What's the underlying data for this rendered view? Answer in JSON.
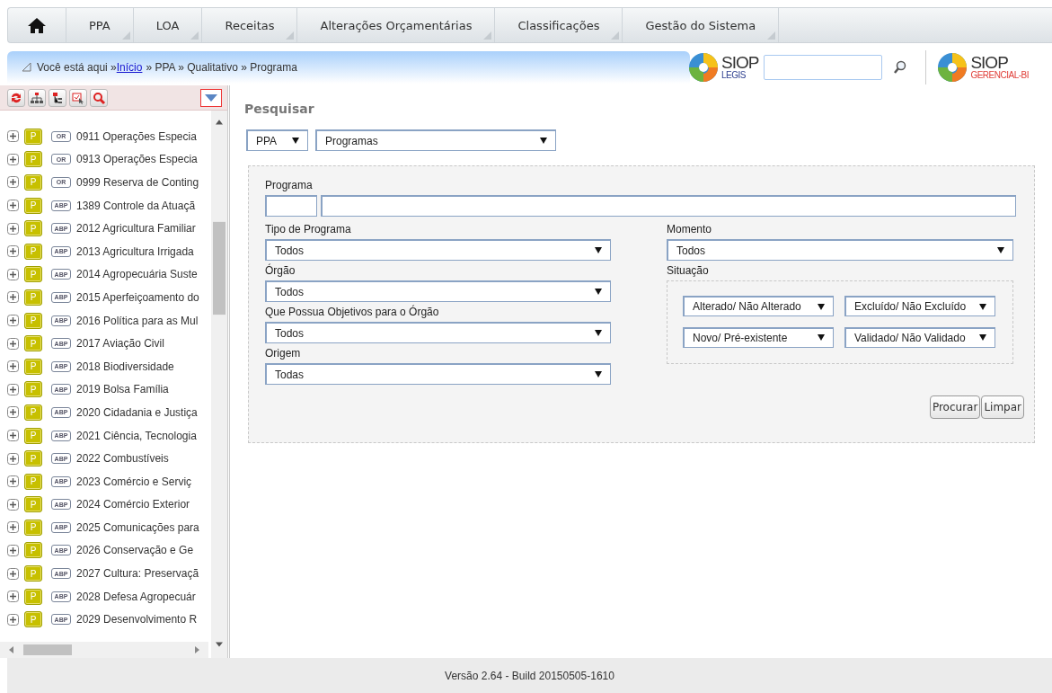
{
  "nav": {
    "items": [
      {
        "kind": "home"
      },
      {
        "kind": "menu",
        "label": "PPA"
      },
      {
        "kind": "menu",
        "label": "LOA"
      },
      {
        "kind": "menu",
        "label": "Receitas"
      },
      {
        "kind": "menu",
        "label": "Alterações Orçamentárias"
      },
      {
        "kind": "menu",
        "label": "Classificações"
      },
      {
        "kind": "menu",
        "label": "Gestão do Sistema"
      }
    ]
  },
  "breadcrumb": {
    "prefix": "Você está aqui »",
    "link": "Início",
    "rest": "» PPA » Qualitativo » Programa"
  },
  "logos": [
    {
      "title": "SIOP",
      "subtitle": "LEGIS",
      "color": "#2e3f8f"
    },
    {
      "title": "SIOP",
      "subtitle": "GERENCIAL-BI",
      "color": "#e0403a"
    }
  ],
  "tree": {
    "items": [
      {
        "badge": "P",
        "tag": "OR",
        "label": "0911 Operações Especia"
      },
      {
        "badge": "P",
        "tag": "OR",
        "label": "0913 Operações Especia"
      },
      {
        "badge": "P",
        "tag": "OR",
        "label": "0999 Reserva de Conting"
      },
      {
        "badge": "P",
        "tag": "ABP",
        "label": "1389 Controle da Atuaçã"
      },
      {
        "badge": "P",
        "tag": "ABP",
        "label": "2012 Agricultura Familiar"
      },
      {
        "badge": "P",
        "tag": "ABP",
        "label": "2013 Agricultura Irrigada"
      },
      {
        "badge": "P",
        "tag": "ABP",
        "label": "2014 Agropecuária Suste"
      },
      {
        "badge": "P",
        "tag": "ABP",
        "label": "2015 Aperfeiçoamento do"
      },
      {
        "badge": "P",
        "tag": "ABP",
        "label": "2016 Política para as Mul"
      },
      {
        "badge": "P",
        "tag": "ABP",
        "label": "2017 Aviação Civil"
      },
      {
        "badge": "P",
        "tag": "ABP",
        "label": "2018 Biodiversidade"
      },
      {
        "badge": "P",
        "tag": "ABP",
        "label": "2019 Bolsa Família"
      },
      {
        "badge": "P",
        "tag": "ABP",
        "label": "2020 Cidadania e Justiça"
      },
      {
        "badge": "P",
        "tag": "ABP",
        "label": "2021 Ciência, Tecnologia"
      },
      {
        "badge": "P",
        "tag": "ABP",
        "label": "2022 Combustíveis"
      },
      {
        "badge": "P",
        "tag": "ABP",
        "label": "2023 Comércio e Serviç"
      },
      {
        "badge": "P",
        "tag": "ABP",
        "label": "2024 Comércio Exterior"
      },
      {
        "badge": "P",
        "tag": "ABP",
        "label": "2025 Comunicações para"
      },
      {
        "badge": "P",
        "tag": "ABP",
        "label": "2026 Conservação e Ge"
      },
      {
        "badge": "P",
        "tag": "ABP",
        "label": "2027 Cultura: Preservaçã"
      },
      {
        "badge": "P",
        "tag": "ABP",
        "label": "2028 Defesa Agropecuár"
      },
      {
        "badge": "P",
        "tag": "ABP",
        "label": "2029 Desenvolvimento R"
      }
    ]
  },
  "search": {
    "title": "Pesquisar",
    "plan": "PPA",
    "object": "Programas",
    "program_label": "Programa",
    "left_fields": [
      {
        "label": "Tipo de Programa",
        "value": "Todos"
      },
      {
        "label": "Órgão",
        "value": "Todos"
      },
      {
        "label": "Que Possua Objetivos para o Órgão",
        "value": "Todos"
      },
      {
        "label": "Origem",
        "value": "Todas"
      }
    ],
    "moment": {
      "label": "Momento",
      "value": "Todos"
    },
    "situation": {
      "label": "Situação",
      "filters": [
        "Alterado/ Não Alterado",
        "Excluído/ Não Excluído",
        "Novo/ Pré-existente",
        "Validado/ Não Validado"
      ]
    },
    "buttons": [
      "Procurar",
      "Limpar"
    ]
  },
  "status_bar": "Versão 2.64 - Build 20150505-1610"
}
